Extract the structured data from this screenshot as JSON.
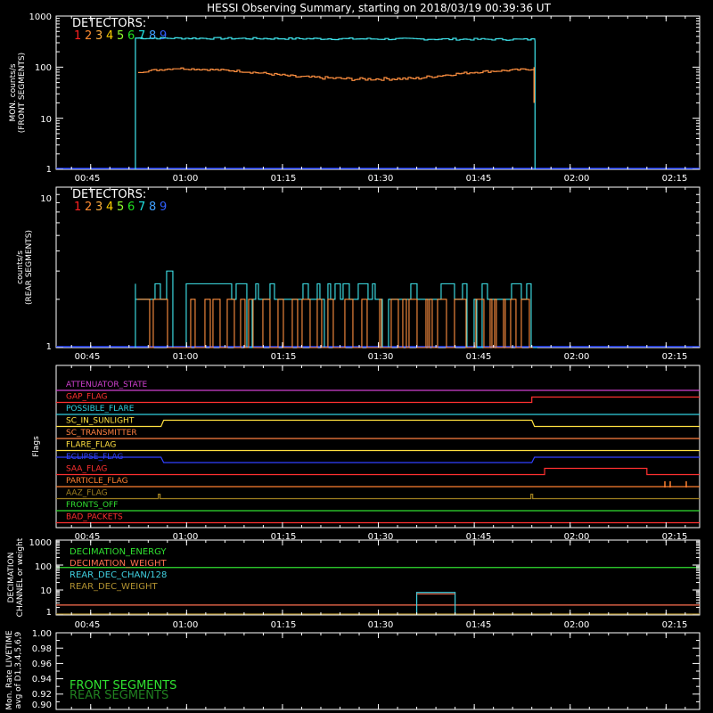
{
  "title": "HESSI Observing Summary, starting on 2018/03/19 00:39:36 UT",
  "time_ticks": [
    "00:45",
    "01:00",
    "01:15",
    "01:30",
    "01:45",
    "02:00",
    "02:15"
  ],
  "colors": {
    "axis": "#ffffff",
    "det_digits": [
      "#e8e8e8",
      "#ff2020",
      "#ff8a30",
      "#ffb040",
      "#ffd000",
      "#90ff30",
      "#20e020",
      "#20e0e0",
      "#40a0ff",
      "#3060ff"
    ],
    "front_cyan": "#40e8f0",
    "front_orange": "#ff9040",
    "baseline": "#2040ff"
  },
  "panels": {
    "front": {
      "ylabel_lines": [
        "MON. counts/s",
        "(FRONT SEGMENTS)"
      ],
      "ytick_labels": [
        "1000",
        "100",
        "10",
        "1"
      ],
      "legend_title": "DETECTORS:",
      "legend_digits": [
        "1",
        "2",
        "3",
        "4",
        "5",
        "6",
        "7",
        "8",
        "9"
      ]
    },
    "rear": {
      "ylabel_lines": [
        "counts/s",
        "(REAR SEGMENTS)"
      ],
      "ytick_labels": [
        "10",
        "1"
      ],
      "legend_title": "DETECTORS:",
      "legend_digits": [
        "1",
        "2",
        "3",
        "4",
        "5",
        "6",
        "7",
        "8",
        "9"
      ]
    },
    "flags": {
      "ylabel": "Flags",
      "items": [
        {
          "label": "ATTENUATOR_STATE",
          "color": "#d040d0"
        },
        {
          "label": "GAP_FLAG",
          "color": "#ff3030"
        },
        {
          "label": "POSSIBLE_FLARE",
          "color": "#30d0e0"
        },
        {
          "label": "SC_IN_SUNLIGHT",
          "color": "#ffe040"
        },
        {
          "label": "SC_TRANSMITTER",
          "color": "#ff8040"
        },
        {
          "label": "FLARE_FLAG",
          "color": "#ffe040"
        },
        {
          "label": "ECLIPSE_FLAG",
          "color": "#3040ff"
        },
        {
          "label": "SAA_FLAG",
          "color": "#ff3030"
        },
        {
          "label": "PARTICLE_FLAG",
          "color": "#ff8030"
        },
        {
          "label": "AAZ_FLAG",
          "color": "#a08020"
        },
        {
          "label": "FRONTS_OFF",
          "color": "#30e030"
        },
        {
          "label": "BAD_PACKETS",
          "color": "#ff3030"
        }
      ]
    },
    "decimation": {
      "ylabel_lines": [
        "DECIMATION",
        "CHANNEL or weight"
      ],
      "ytick_labels": [
        "1000",
        "100",
        "10",
        "1"
      ],
      "legend": [
        {
          "label": "DECIMATION_ENERGY",
          "color": "#30e030"
        },
        {
          "label": "DECIMATION_WEIGHT",
          "color": "#ff7050"
        },
        {
          "label": "REAR_DEC_CHAN/128",
          "color": "#40d0e0"
        },
        {
          "label": "REAR_DEC_WEIGHT",
          "color": "#b09030"
        }
      ]
    },
    "livetime": {
      "ylabel_lines": [
        "Mon. Rate LIVETIME",
        "avg of D1,3,4,5,6,9"
      ],
      "ytick_labels": [
        "1.00",
        "0.98",
        "0.96",
        "0.94",
        "0.92",
        "0.90"
      ],
      "legend": [
        {
          "label": "FRONT SEGMENTS",
          "color": "#30e030"
        },
        {
          "label": "REAR SEGMENTS",
          "color": "#208020"
        }
      ]
    }
  },
  "chart_data": [
    {
      "type": "line",
      "title": "HESSI Observing Summary, starting on 2018/03/19 00:39:36 UT",
      "ylabel": "MON. counts/s (FRONT SEGMENTS)",
      "yscale": "log",
      "ylim": [
        1,
        1000
      ],
      "x_range": [
        "00:39:36",
        "02:20"
      ],
      "series": [
        {
          "name": "8",
          "x": [
            "00:52",
            "00:58",
            "01:15",
            "01:30",
            "01:45",
            "01:54",
            "01:54:30"
          ],
          "values": [
            380,
            370,
            365,
            365,
            360,
            350,
            1
          ]
        },
        {
          "name": "3",
          "x": [
            "00:52",
            "00:58",
            "01:10",
            "01:20",
            "01:30",
            "01:40",
            "01:50",
            "01:54",
            "01:54:30"
          ],
          "values": [
            85,
            95,
            75,
            60,
            55,
            65,
            85,
            90,
            20
          ]
        }
      ]
    },
    {
      "type": "line",
      "ylabel": "counts/s (REAR SEGMENTS)",
      "yscale": "log",
      "ylim": [
        1,
        10
      ],
      "x_range": [
        "00:39:36",
        "02:20"
      ],
      "series": [
        {
          "name": "8",
          "x": [
            "00:52",
            "00:57",
            "01:05",
            "01:20",
            "01:36",
            "01:42",
            "01:50",
            "01:54"
          ],
          "values": [
            2.5,
            3.0,
            2.5,
            2.0,
            2.5,
            2.0,
            2.5,
            2.0
          ]
        },
        {
          "name": "3",
          "x": [
            "00:52",
            "00:57",
            "01:05",
            "01:20",
            "01:36",
            "01:42",
            "01:50",
            "01:54"
          ],
          "values": [
            2.0,
            2.0,
            2.0,
            2.0,
            2.0,
            2.0,
            2.0,
            2.0
          ]
        }
      ]
    },
    {
      "type": "line",
      "ylabel": "Flags",
      "series": [
        {
          "name": "ATTENUATOR_STATE",
          "values": [
            0
          ]
        },
        {
          "name": "GAP_FLAG",
          "values": [
            0,
            1
          ]
        },
        {
          "name": "POSSIBLE_FLARE",
          "values": [
            0
          ]
        },
        {
          "name": "SC_IN_SUNLIGHT",
          "values": [
            0,
            1,
            0
          ]
        },
        {
          "name": "SC_TRANSMITTER",
          "values": [
            0
          ]
        },
        {
          "name": "FLARE_FLAG",
          "values": [
            0
          ]
        },
        {
          "name": "ECLIPSE_FLAG",
          "values": [
            1,
            0,
            1
          ]
        },
        {
          "name": "SAA_FLAG",
          "values": [
            0,
            1,
            0
          ]
        },
        {
          "name": "PARTICLE_FLAG",
          "values": [
            0
          ]
        },
        {
          "name": "AAZ_FLAG",
          "values": [
            0
          ]
        },
        {
          "name": "FRONTS_OFF",
          "values": [
            0
          ]
        },
        {
          "name": "BAD_PACKETS",
          "values": [
            0
          ]
        }
      ]
    },
    {
      "type": "line",
      "ylabel": "DECIMATION CHANNEL or weight",
      "yscale": "log",
      "ylim": [
        1,
        1000
      ],
      "series": [
        {
          "name": "DECIMATION_ENERGY",
          "values": [
            80
          ]
        },
        {
          "name": "DECIMATION_WEIGHT",
          "values": [
            2.5
          ]
        },
        {
          "name": "REAR_DEC_CHAN/128",
          "x": [
            "01:36",
            "01:42"
          ],
          "values": [
            8,
            8
          ]
        },
        {
          "name": "REAR_DEC_WEIGHT",
          "values": [
            1
          ]
        }
      ]
    },
    {
      "type": "line",
      "ylabel": "Mon. Rate LIVETIME avg of D1,3,4,5,6,9",
      "ylim": [
        0.9,
        1.0
      ],
      "series": [
        {
          "name": "FRONT SEGMENTS",
          "values": []
        },
        {
          "name": "REAR SEGMENTS",
          "values": []
        }
      ]
    }
  ]
}
